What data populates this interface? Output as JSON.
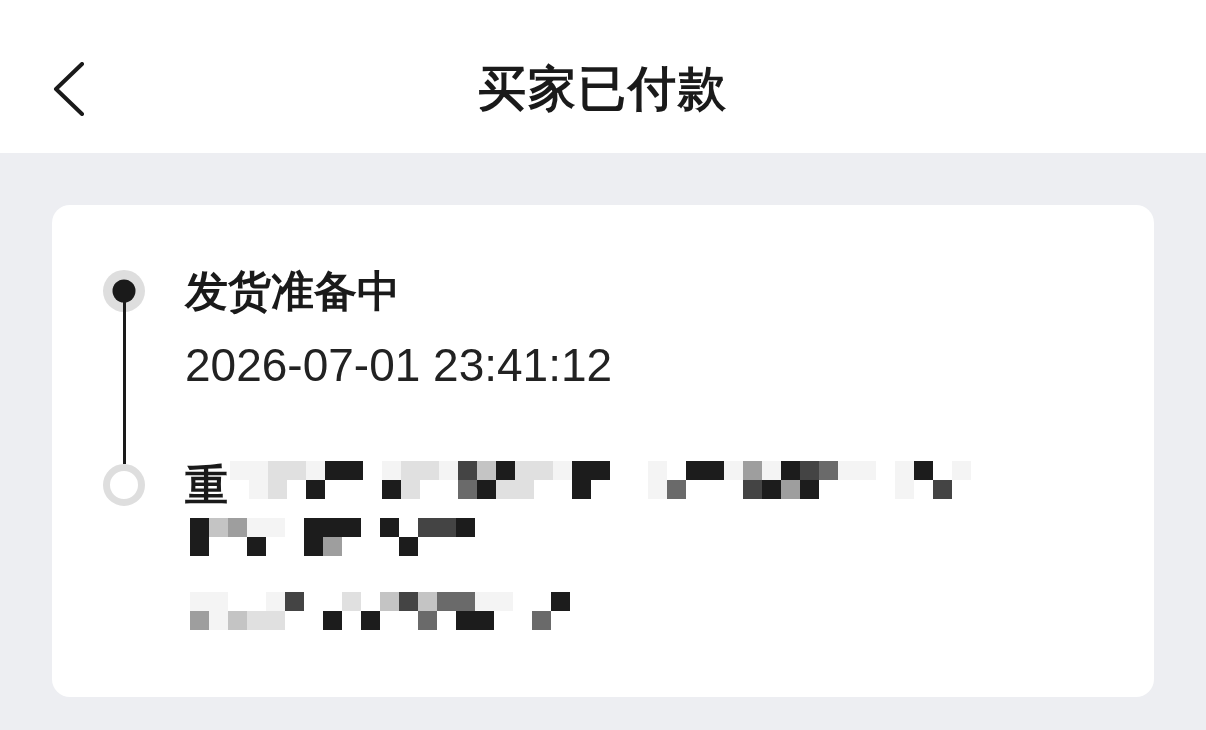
{
  "header": {
    "title": "买家已付款"
  },
  "timeline": [
    {
      "title": "发货准备中",
      "time": "2026-07-01 23:41:12",
      "active": true
    },
    {
      "title": "重",
      "active": false,
      "redacted": true
    }
  ]
}
